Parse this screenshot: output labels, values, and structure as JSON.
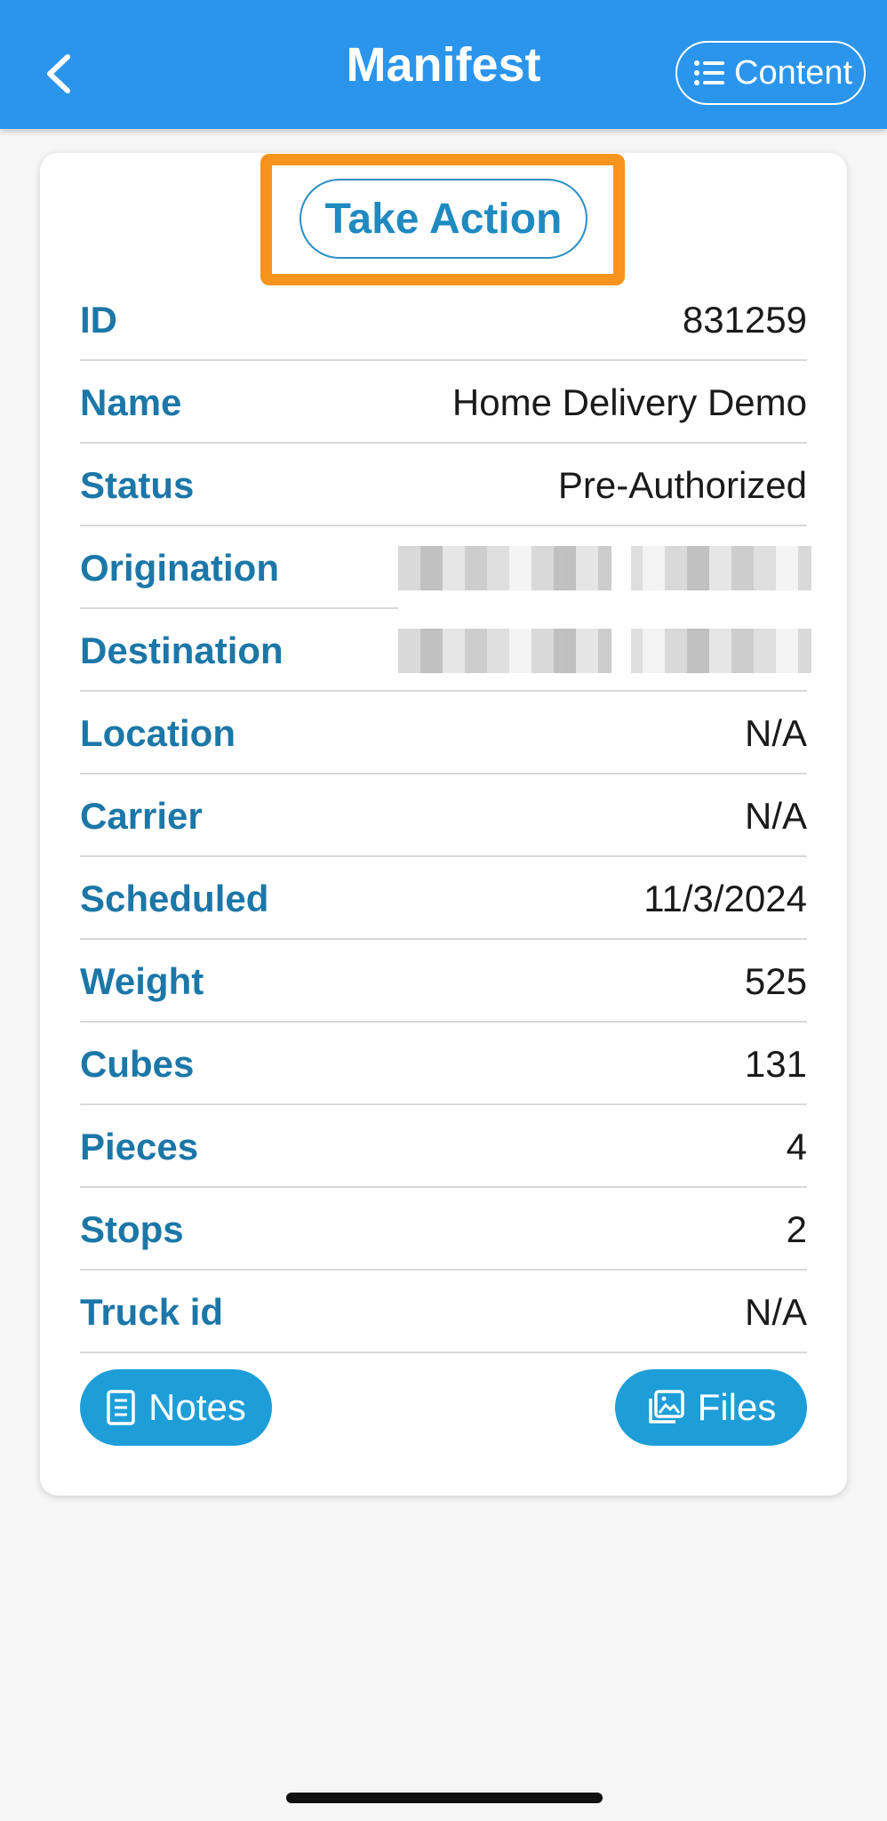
{
  "header": {
    "title": "Manifest",
    "back_icon": "chevron-left-icon",
    "content_button_label": "Content",
    "content_icon": "list-icon"
  },
  "card": {
    "take_action_label": "Take Action",
    "rows": [
      {
        "label": "ID",
        "value": "831259"
      },
      {
        "label": "Name",
        "value": "Home Delivery Demo"
      },
      {
        "label": "Status",
        "value": "Pre-Authorized"
      },
      {
        "label": "Origination",
        "value": ""
      },
      {
        "label": "Destination",
        "value": ""
      },
      {
        "label": "Location",
        "value": "N/A"
      },
      {
        "label": "Carrier",
        "value": "N/A"
      },
      {
        "label": "Scheduled",
        "value": "11/3/2024"
      },
      {
        "label": "Weight",
        "value": "525"
      },
      {
        "label": "Cubes",
        "value": "131"
      },
      {
        "label": "Pieces",
        "value": "4"
      },
      {
        "label": "Stops",
        "value": "2"
      },
      {
        "label": "Truck id",
        "value": "N/A"
      }
    ],
    "notes_label": "Notes",
    "notes_icon": "document-icon",
    "files_label": "Files",
    "files_icon": "image-gallery-icon"
  },
  "colors": {
    "header_bg": "#2b95ec",
    "label": "#1c77a8",
    "accent_button": "#1e9ed8",
    "highlight": "#f7941d"
  }
}
